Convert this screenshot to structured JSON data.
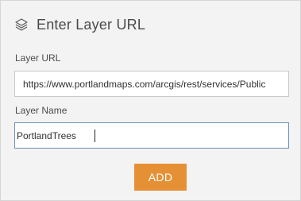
{
  "dialog": {
    "title": "Enter Layer URL",
    "icon": "layers-icon"
  },
  "layer_url": {
    "label": "Layer URL",
    "value": "https://www.portlandmaps.com/arcgis/rest/services/Public"
  },
  "layer_name": {
    "label": "Layer Name",
    "value": "PortlandTrees"
  },
  "actions": {
    "add_label": "ADD"
  },
  "colors": {
    "accent_button": "#e69036",
    "panel_background": "#f3f3f3",
    "focused_border": "#6a8fb5"
  }
}
